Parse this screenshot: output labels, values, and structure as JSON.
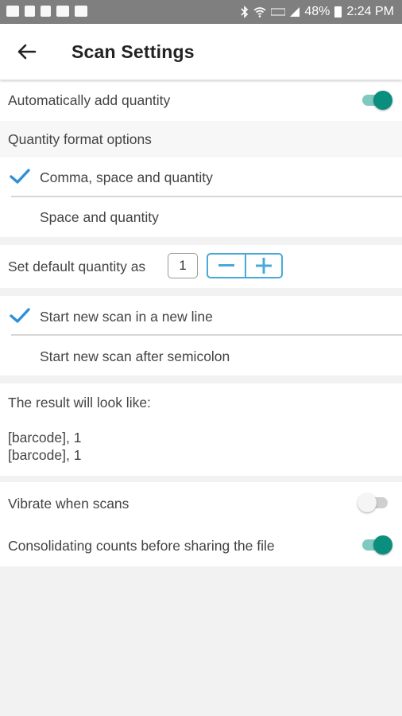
{
  "status_bar": {
    "battery": "48%",
    "time": "2:24 PM",
    "left_icons": [
      "mail-icon",
      "missed-call-icon",
      "sim-icon",
      "image-icon",
      "youtube-icon"
    ],
    "right_icons": [
      "bluetooth-icon",
      "wifi-icon",
      "lte-icon",
      "signal-icon",
      "battery-icon"
    ]
  },
  "app_bar": {
    "back_icon": "arrow-left-icon",
    "title": "Scan Settings"
  },
  "auto_add": {
    "label": "Automatically add quantity",
    "enabled": true
  },
  "quantity_format": {
    "header": "Quantity format options",
    "options": [
      {
        "label": "Comma, space and quantity",
        "selected": true
      },
      {
        "label": "Space and quantity",
        "selected": false
      }
    ]
  },
  "default_quantity": {
    "label": "Set default quantity as",
    "value": "1",
    "minus_icon": "minus-icon",
    "plus_icon": "plus-icon"
  },
  "scan_line": {
    "options": [
      {
        "label": "Start new scan in a new line",
        "selected": true
      },
      {
        "label": "Start new scan after semicolon",
        "selected": false
      }
    ]
  },
  "result": {
    "header": "The result will look like:",
    "lines": [
      "[barcode], 1",
      "[barcode], 1"
    ]
  },
  "vibrate": {
    "label": "Vibrate when scans",
    "enabled": false
  },
  "consolidate": {
    "label": "Consolidating counts before sharing the file",
    "enabled": true
  },
  "colors": {
    "accent": "#0a8f7f",
    "accent_track": "#7fc9c0",
    "check": "#2e8fd8",
    "stepper": "#49a9d8",
    "status_bar": "#7f7f7f"
  }
}
